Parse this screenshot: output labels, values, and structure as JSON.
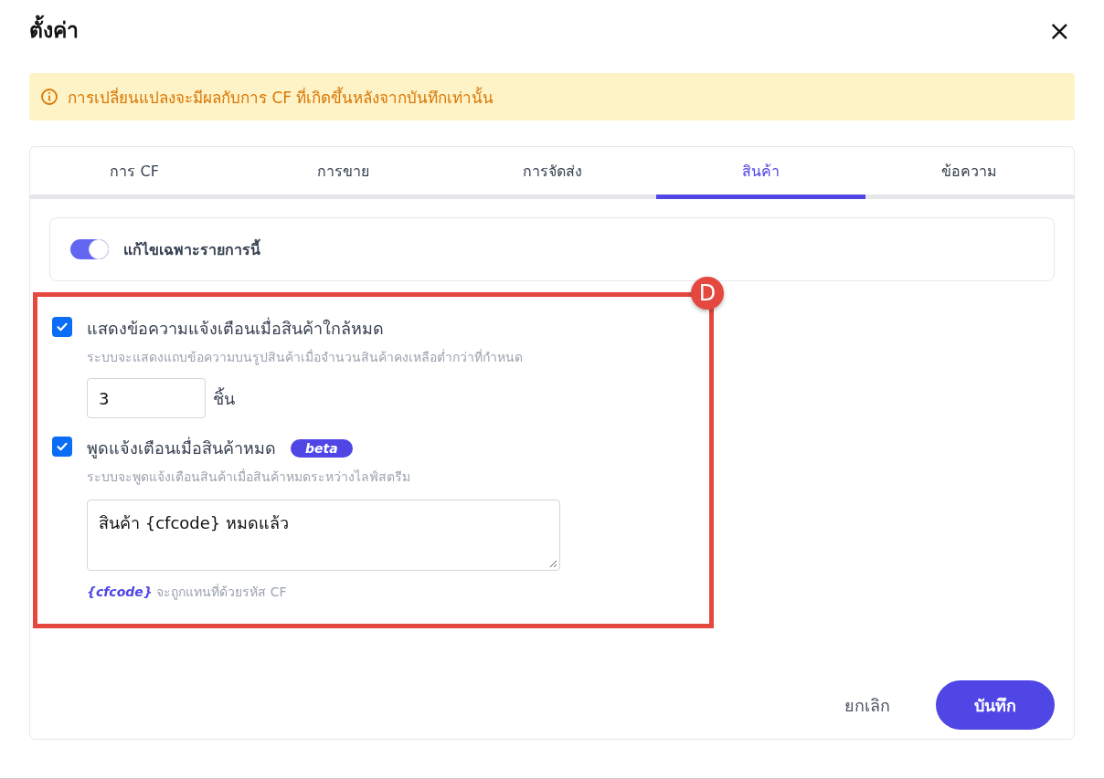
{
  "dialog": {
    "title": "ตั้งค่า",
    "close": "×"
  },
  "notice": {
    "text": "การเปลี่ยนแปลงจะมีผลกับการ CF ที่เกิดขึ้นหลังจากบันทึกเท่านั้น"
  },
  "tabs": [
    {
      "label": "การ CF",
      "selected": false
    },
    {
      "label": "การขาย",
      "selected": false
    },
    {
      "label": "การจัดส่ง",
      "selected": false
    },
    {
      "label": "สินค้า",
      "selected": true
    },
    {
      "label": "ข้อความ",
      "selected": false
    }
  ],
  "override": {
    "label": "แก้ไขเฉพาะรายการนี้",
    "on": true
  },
  "annotation": {
    "label": "D"
  },
  "options": [
    {
      "kind": "number",
      "label": "แสดงข้อความแจ้งเตือนเมื่อสินค้าใกล้หมด",
      "checked": true,
      "description": "ระบบจะแสดงแถบข้อความบนรูปสินค้าเมื่อจำนวนสินค้าคงเหลือต่ำกว่าที่กำหนด",
      "value": "3",
      "unit": "ชิ้น"
    },
    {
      "kind": "text",
      "label": "พูดแจ้งเตือนเมื่อสินค้าหมด",
      "checked": true,
      "badge": "beta",
      "description": "ระบบจะพูดแจ้งเตือนสินค้าเมื่อสินค้าหมดระหว่างไลฟ์สตรีม",
      "value": "สินค้า {cfcode} หมดแล้ว",
      "hint": "*{cfcode}* จะถูกแทนที่ด้วยรหัส CF"
    }
  ],
  "buttons": {
    "cancel": "ยกเลิก",
    "save": "บันทึก"
  }
}
